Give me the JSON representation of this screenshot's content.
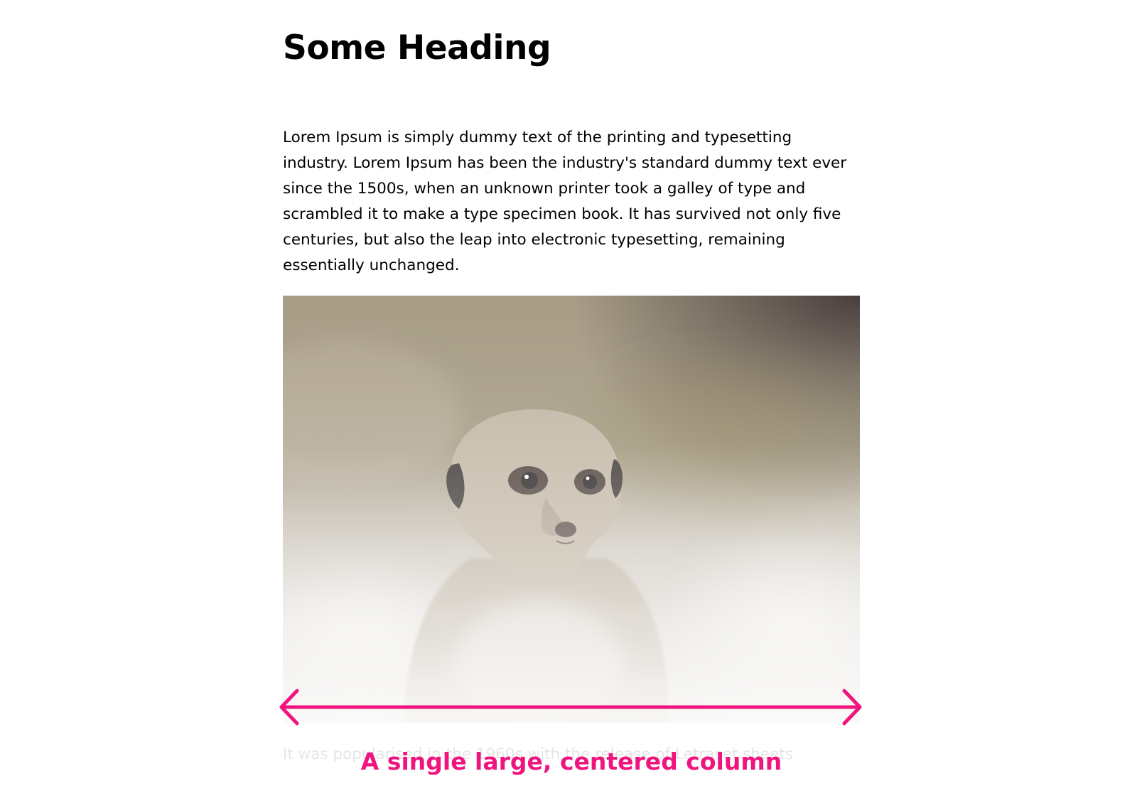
{
  "heading": "Some Heading",
  "paragraph": "Lorem Ipsum is simply dummy text of the printing and typesetting industry. Lorem Ipsum has been the industry's standard dummy text ever since the 1500s, when an unknown printer took a galley of type and scrambled it to make a type specimen book. It has survived not only five centuries, but also the leap into electronic typesetting, remaining essentially unchanged.",
  "faded_text": "It was popularised in the 1960s with the release of Letraset sheets",
  "annotation": {
    "label": "A single large, centered column",
    "color": "#f0147f"
  },
  "image": {
    "subject": "meerkat"
  }
}
